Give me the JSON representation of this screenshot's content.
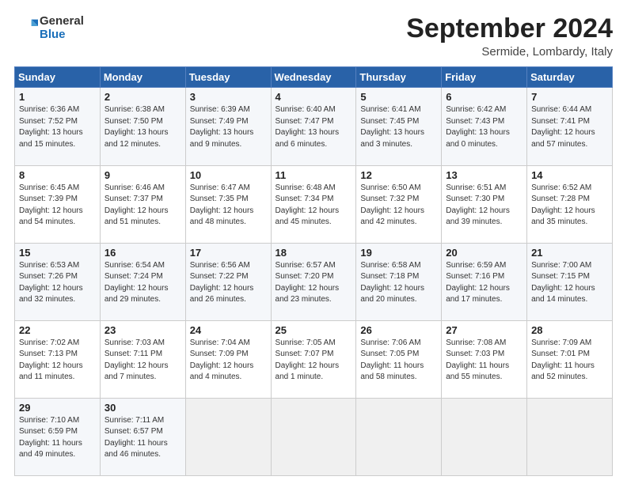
{
  "logo": {
    "line1": "General",
    "line2": "Blue"
  },
  "header": {
    "month": "September 2024",
    "location": "Sermide, Lombardy, Italy"
  },
  "weekdays": [
    "Sunday",
    "Monday",
    "Tuesday",
    "Wednesday",
    "Thursday",
    "Friday",
    "Saturday"
  ],
  "weeks": [
    [
      {
        "day": "1",
        "info": "Sunrise: 6:36 AM\nSunset: 7:52 PM\nDaylight: 13 hours\nand 15 minutes."
      },
      {
        "day": "2",
        "info": "Sunrise: 6:38 AM\nSunset: 7:50 PM\nDaylight: 13 hours\nand 12 minutes."
      },
      {
        "day": "3",
        "info": "Sunrise: 6:39 AM\nSunset: 7:49 PM\nDaylight: 13 hours\nand 9 minutes."
      },
      {
        "day": "4",
        "info": "Sunrise: 6:40 AM\nSunset: 7:47 PM\nDaylight: 13 hours\nand 6 minutes."
      },
      {
        "day": "5",
        "info": "Sunrise: 6:41 AM\nSunset: 7:45 PM\nDaylight: 13 hours\nand 3 minutes."
      },
      {
        "day": "6",
        "info": "Sunrise: 6:42 AM\nSunset: 7:43 PM\nDaylight: 13 hours\nand 0 minutes."
      },
      {
        "day": "7",
        "info": "Sunrise: 6:44 AM\nSunset: 7:41 PM\nDaylight: 12 hours\nand 57 minutes."
      }
    ],
    [
      {
        "day": "8",
        "info": "Sunrise: 6:45 AM\nSunset: 7:39 PM\nDaylight: 12 hours\nand 54 minutes."
      },
      {
        "day": "9",
        "info": "Sunrise: 6:46 AM\nSunset: 7:37 PM\nDaylight: 12 hours\nand 51 minutes."
      },
      {
        "day": "10",
        "info": "Sunrise: 6:47 AM\nSunset: 7:35 PM\nDaylight: 12 hours\nand 48 minutes."
      },
      {
        "day": "11",
        "info": "Sunrise: 6:48 AM\nSunset: 7:34 PM\nDaylight: 12 hours\nand 45 minutes."
      },
      {
        "day": "12",
        "info": "Sunrise: 6:50 AM\nSunset: 7:32 PM\nDaylight: 12 hours\nand 42 minutes."
      },
      {
        "day": "13",
        "info": "Sunrise: 6:51 AM\nSunset: 7:30 PM\nDaylight: 12 hours\nand 39 minutes."
      },
      {
        "day": "14",
        "info": "Sunrise: 6:52 AM\nSunset: 7:28 PM\nDaylight: 12 hours\nand 35 minutes."
      }
    ],
    [
      {
        "day": "15",
        "info": "Sunrise: 6:53 AM\nSunset: 7:26 PM\nDaylight: 12 hours\nand 32 minutes."
      },
      {
        "day": "16",
        "info": "Sunrise: 6:54 AM\nSunset: 7:24 PM\nDaylight: 12 hours\nand 29 minutes."
      },
      {
        "day": "17",
        "info": "Sunrise: 6:56 AM\nSunset: 7:22 PM\nDaylight: 12 hours\nand 26 minutes."
      },
      {
        "day": "18",
        "info": "Sunrise: 6:57 AM\nSunset: 7:20 PM\nDaylight: 12 hours\nand 23 minutes."
      },
      {
        "day": "19",
        "info": "Sunrise: 6:58 AM\nSunset: 7:18 PM\nDaylight: 12 hours\nand 20 minutes."
      },
      {
        "day": "20",
        "info": "Sunrise: 6:59 AM\nSunset: 7:16 PM\nDaylight: 12 hours\nand 17 minutes."
      },
      {
        "day": "21",
        "info": "Sunrise: 7:00 AM\nSunset: 7:15 PM\nDaylight: 12 hours\nand 14 minutes."
      }
    ],
    [
      {
        "day": "22",
        "info": "Sunrise: 7:02 AM\nSunset: 7:13 PM\nDaylight: 12 hours\nand 11 minutes."
      },
      {
        "day": "23",
        "info": "Sunrise: 7:03 AM\nSunset: 7:11 PM\nDaylight: 12 hours\nand 7 minutes."
      },
      {
        "day": "24",
        "info": "Sunrise: 7:04 AM\nSunset: 7:09 PM\nDaylight: 12 hours\nand 4 minutes."
      },
      {
        "day": "25",
        "info": "Sunrise: 7:05 AM\nSunset: 7:07 PM\nDaylight: 12 hours\nand 1 minute."
      },
      {
        "day": "26",
        "info": "Sunrise: 7:06 AM\nSunset: 7:05 PM\nDaylight: 11 hours\nand 58 minutes."
      },
      {
        "day": "27",
        "info": "Sunrise: 7:08 AM\nSunset: 7:03 PM\nDaylight: 11 hours\nand 55 minutes."
      },
      {
        "day": "28",
        "info": "Sunrise: 7:09 AM\nSunset: 7:01 PM\nDaylight: 11 hours\nand 52 minutes."
      }
    ],
    [
      {
        "day": "29",
        "info": "Sunrise: 7:10 AM\nSunset: 6:59 PM\nDaylight: 11 hours\nand 49 minutes."
      },
      {
        "day": "30",
        "info": "Sunrise: 7:11 AM\nSunset: 6:57 PM\nDaylight: 11 hours\nand 46 minutes."
      },
      null,
      null,
      null,
      null,
      null
    ]
  ]
}
